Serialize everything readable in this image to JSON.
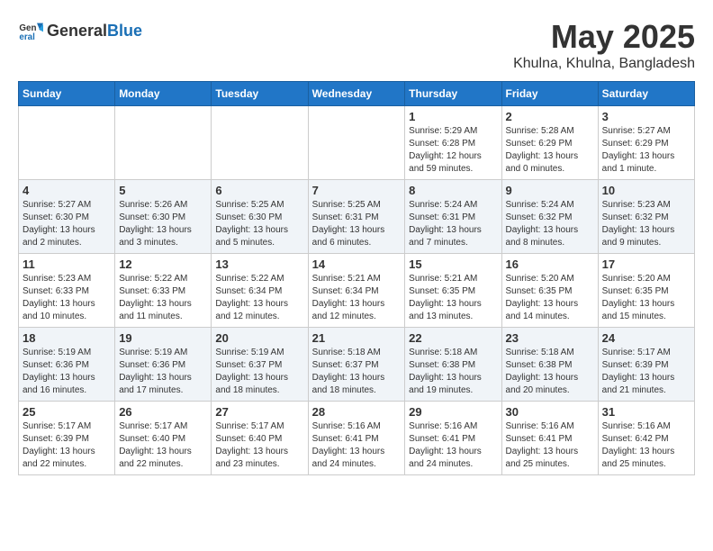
{
  "header": {
    "logo_general": "General",
    "logo_blue": "Blue",
    "month": "May 2025",
    "location": "Khulna, Khulna, Bangladesh"
  },
  "weekdays": [
    "Sunday",
    "Monday",
    "Tuesday",
    "Wednesday",
    "Thursday",
    "Friday",
    "Saturday"
  ],
  "weeks": [
    [
      {
        "day": "",
        "info": ""
      },
      {
        "day": "",
        "info": ""
      },
      {
        "day": "",
        "info": ""
      },
      {
        "day": "",
        "info": ""
      },
      {
        "day": "1",
        "info": "Sunrise: 5:29 AM\nSunset: 6:28 PM\nDaylight: 12 hours and 59 minutes."
      },
      {
        "day": "2",
        "info": "Sunrise: 5:28 AM\nSunset: 6:29 PM\nDaylight: 13 hours and 0 minutes."
      },
      {
        "day": "3",
        "info": "Sunrise: 5:27 AM\nSunset: 6:29 PM\nDaylight: 13 hours and 1 minute."
      }
    ],
    [
      {
        "day": "4",
        "info": "Sunrise: 5:27 AM\nSunset: 6:30 PM\nDaylight: 13 hours and 2 minutes."
      },
      {
        "day": "5",
        "info": "Sunrise: 5:26 AM\nSunset: 6:30 PM\nDaylight: 13 hours and 3 minutes."
      },
      {
        "day": "6",
        "info": "Sunrise: 5:25 AM\nSunset: 6:30 PM\nDaylight: 13 hours and 5 minutes."
      },
      {
        "day": "7",
        "info": "Sunrise: 5:25 AM\nSunset: 6:31 PM\nDaylight: 13 hours and 6 minutes."
      },
      {
        "day": "8",
        "info": "Sunrise: 5:24 AM\nSunset: 6:31 PM\nDaylight: 13 hours and 7 minutes."
      },
      {
        "day": "9",
        "info": "Sunrise: 5:24 AM\nSunset: 6:32 PM\nDaylight: 13 hours and 8 minutes."
      },
      {
        "day": "10",
        "info": "Sunrise: 5:23 AM\nSunset: 6:32 PM\nDaylight: 13 hours and 9 minutes."
      }
    ],
    [
      {
        "day": "11",
        "info": "Sunrise: 5:23 AM\nSunset: 6:33 PM\nDaylight: 13 hours and 10 minutes."
      },
      {
        "day": "12",
        "info": "Sunrise: 5:22 AM\nSunset: 6:33 PM\nDaylight: 13 hours and 11 minutes."
      },
      {
        "day": "13",
        "info": "Sunrise: 5:22 AM\nSunset: 6:34 PM\nDaylight: 13 hours and 12 minutes."
      },
      {
        "day": "14",
        "info": "Sunrise: 5:21 AM\nSunset: 6:34 PM\nDaylight: 13 hours and 12 minutes."
      },
      {
        "day": "15",
        "info": "Sunrise: 5:21 AM\nSunset: 6:35 PM\nDaylight: 13 hours and 13 minutes."
      },
      {
        "day": "16",
        "info": "Sunrise: 5:20 AM\nSunset: 6:35 PM\nDaylight: 13 hours and 14 minutes."
      },
      {
        "day": "17",
        "info": "Sunrise: 5:20 AM\nSunset: 6:35 PM\nDaylight: 13 hours and 15 minutes."
      }
    ],
    [
      {
        "day": "18",
        "info": "Sunrise: 5:19 AM\nSunset: 6:36 PM\nDaylight: 13 hours and 16 minutes."
      },
      {
        "day": "19",
        "info": "Sunrise: 5:19 AM\nSunset: 6:36 PM\nDaylight: 13 hours and 17 minutes."
      },
      {
        "day": "20",
        "info": "Sunrise: 5:19 AM\nSunset: 6:37 PM\nDaylight: 13 hours and 18 minutes."
      },
      {
        "day": "21",
        "info": "Sunrise: 5:18 AM\nSunset: 6:37 PM\nDaylight: 13 hours and 18 minutes."
      },
      {
        "day": "22",
        "info": "Sunrise: 5:18 AM\nSunset: 6:38 PM\nDaylight: 13 hours and 19 minutes."
      },
      {
        "day": "23",
        "info": "Sunrise: 5:18 AM\nSunset: 6:38 PM\nDaylight: 13 hours and 20 minutes."
      },
      {
        "day": "24",
        "info": "Sunrise: 5:17 AM\nSunset: 6:39 PM\nDaylight: 13 hours and 21 minutes."
      }
    ],
    [
      {
        "day": "25",
        "info": "Sunrise: 5:17 AM\nSunset: 6:39 PM\nDaylight: 13 hours and 22 minutes."
      },
      {
        "day": "26",
        "info": "Sunrise: 5:17 AM\nSunset: 6:40 PM\nDaylight: 13 hours and 22 minutes."
      },
      {
        "day": "27",
        "info": "Sunrise: 5:17 AM\nSunset: 6:40 PM\nDaylight: 13 hours and 23 minutes."
      },
      {
        "day": "28",
        "info": "Sunrise: 5:16 AM\nSunset: 6:41 PM\nDaylight: 13 hours and 24 minutes."
      },
      {
        "day": "29",
        "info": "Sunrise: 5:16 AM\nSunset: 6:41 PM\nDaylight: 13 hours and 24 minutes."
      },
      {
        "day": "30",
        "info": "Sunrise: 5:16 AM\nSunset: 6:41 PM\nDaylight: 13 hours and 25 minutes."
      },
      {
        "day": "31",
        "info": "Sunrise: 5:16 AM\nSunset: 6:42 PM\nDaylight: 13 hours and 25 minutes."
      }
    ]
  ]
}
